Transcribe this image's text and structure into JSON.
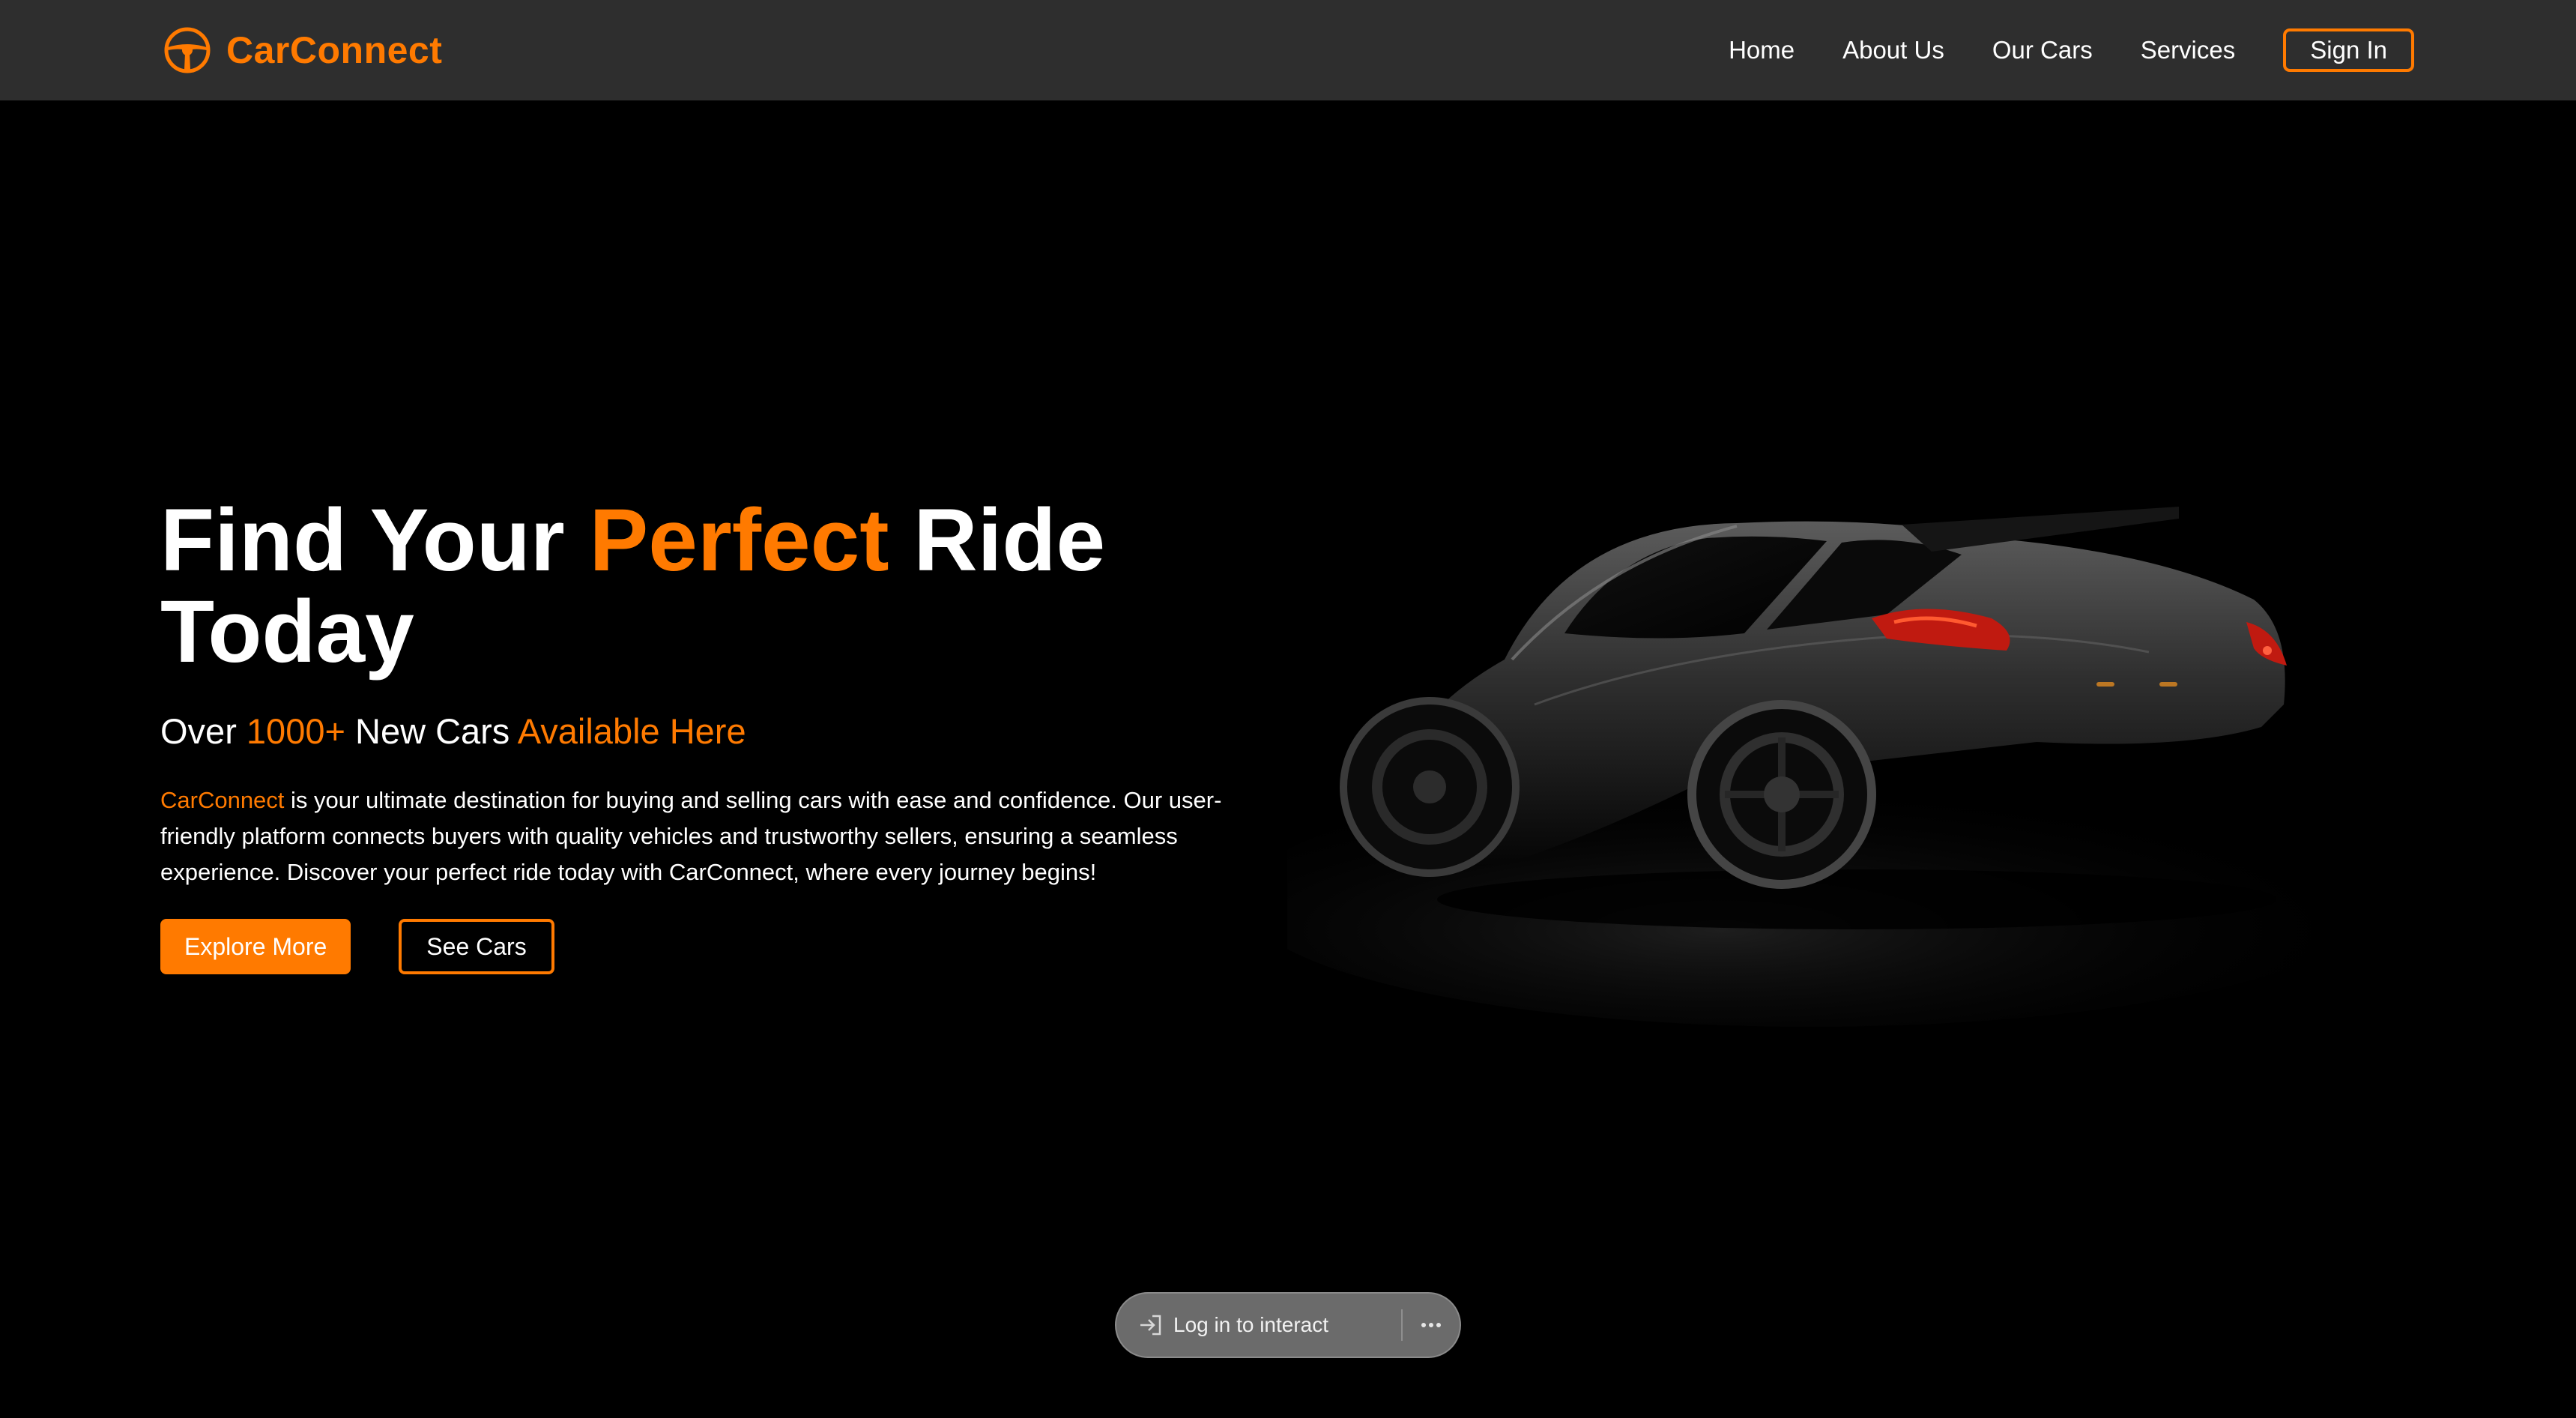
{
  "brand": {
    "name": "CarConnect",
    "icon": "steering-wheel-icon",
    "accent_color": "#ff7a00"
  },
  "nav": {
    "links": [
      "Home",
      "About Us",
      "Our Cars",
      "Services"
    ],
    "signin_label": "Sign In"
  },
  "hero": {
    "title_part1": "Find Your ",
    "title_accent": "Perfect",
    "title_part2": " Ride Today",
    "subtitle_part1": "Over ",
    "subtitle_accent1": "1000+",
    "subtitle_part2": " New Cars ",
    "subtitle_accent2": "Available Here",
    "description_brand": "CarConnect",
    "description_text": " is your ultimate destination for buying and selling cars with ease and confidence. Our user-friendly platform connects buyers with quality vehicles and trustworthy sellers, ensuring a seamless experience. Discover your perfect ride today with CarConnect, where every journey begins!",
    "primary_button": "Explore More",
    "secondary_button": "See Cars"
  },
  "overlay": {
    "login_label": "Log in to interact",
    "login_icon": "sign-in-icon",
    "more_icon": "more-horizontal-icon"
  },
  "colors": {
    "navbar_bg": "#2e2e2e",
    "page_bg": "#000000",
    "accent": "#ff7a00"
  }
}
